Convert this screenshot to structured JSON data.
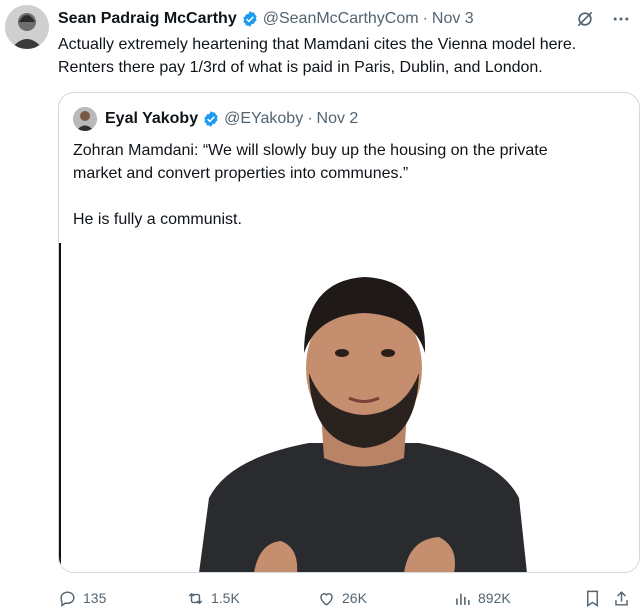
{
  "tweet": {
    "author_name": "Sean Padraig McCarthy",
    "handle": "@SeanMcCarthyCom",
    "date": "Nov 3",
    "text": "Actually extremely heartening that Mamdani cites the Vienna model here.\nRenters there pay 1/3rd of what is paid in Paris, Dublin, and London."
  },
  "quote": {
    "author_name": "Eyal Yakoby",
    "handle": "@EYakoby",
    "date": "Nov 2",
    "text": "Zohran Mamdani: “We will slowly buy up the housing on the private\nmarket and convert properties into communes.”\n\nHe is fully a communist."
  },
  "actions": {
    "replies": "135",
    "reposts": "1.5K",
    "likes": "26K",
    "views": "892K"
  },
  "icons": {
    "verified": "verified-badge-icon",
    "grok": "grok-icon",
    "more": "more-icon",
    "reply": "reply-icon",
    "repost": "repost-icon",
    "like": "heart-icon",
    "views": "views-icon",
    "bookmark": "bookmark-icon",
    "share": "share-icon"
  },
  "colors": {
    "verified": "#1d9bf0",
    "muted": "#536471",
    "border": "#cfd9de"
  }
}
